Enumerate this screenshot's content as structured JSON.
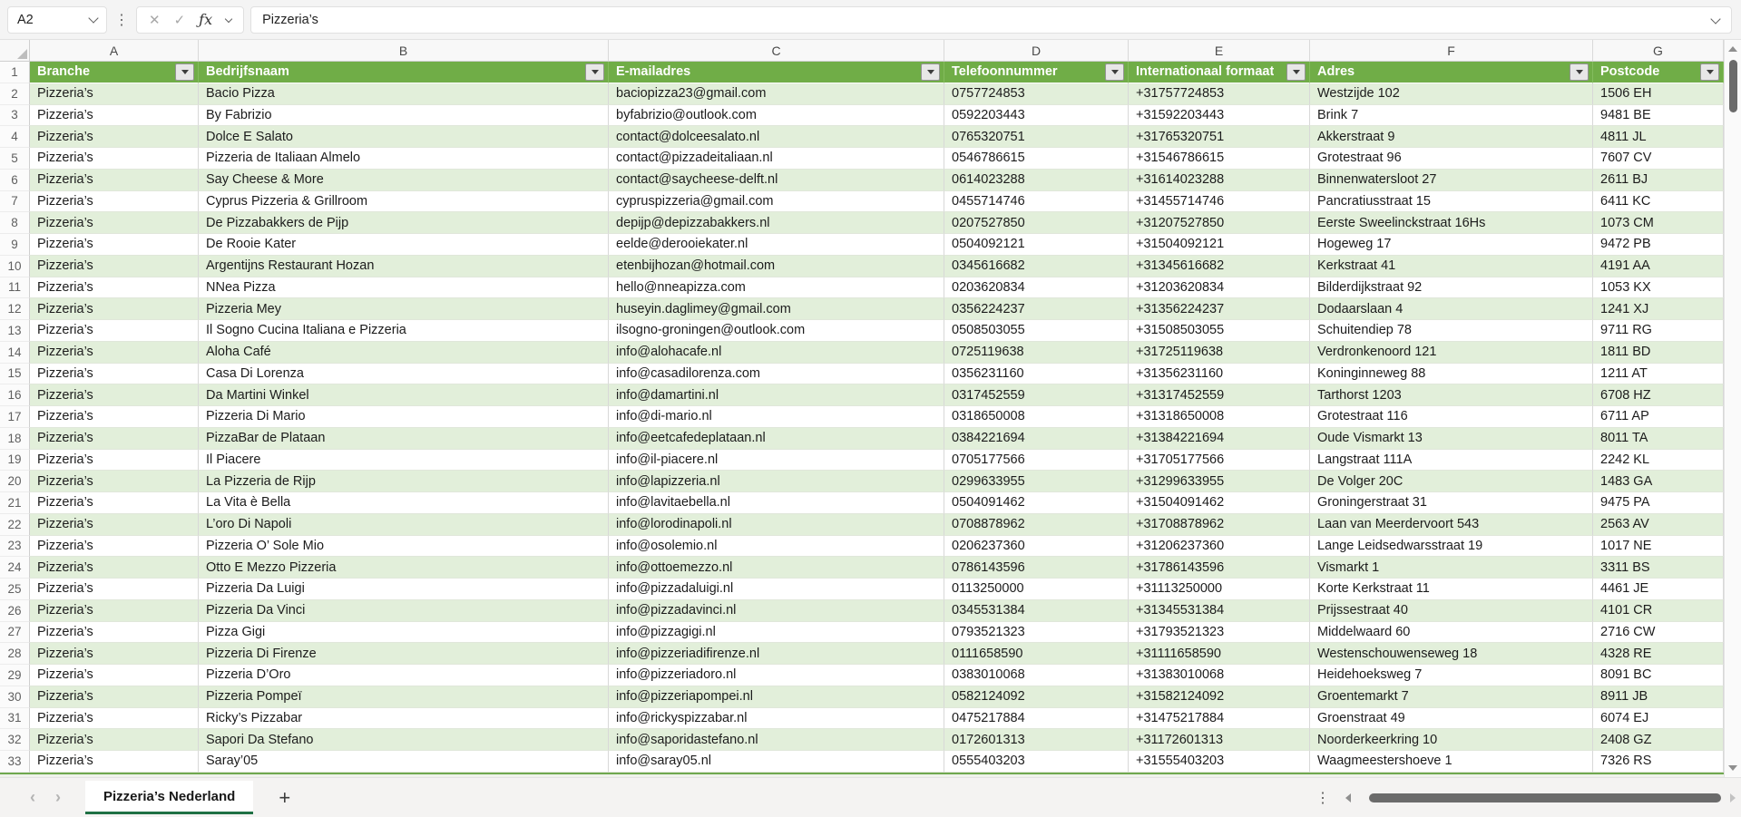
{
  "formula_bar": {
    "name_box": "A2",
    "formula": "Pizzeria’s"
  },
  "icons": {
    "cancel": "✕",
    "confirm": "✓",
    "function": "ƒx",
    "kebab": "⋮",
    "add": "+"
  },
  "colors": {
    "table_header_green": "#70AD47",
    "banded_row_green": "#E2EFDA",
    "active_tab_underline": "#1F7044"
  },
  "sheet": {
    "columns": [
      {
        "letter": "A",
        "header": "Branche"
      },
      {
        "letter": "B",
        "header": "Bedrijfsnaam"
      },
      {
        "letter": "C",
        "header": "E-mailadres"
      },
      {
        "letter": "D",
        "header": "Telefoonnummer"
      },
      {
        "letter": "E",
        "header": "Internationaal formaat"
      },
      {
        "letter": "F",
        "header": "Adres"
      },
      {
        "letter": "G",
        "header": "Postcode"
      }
    ],
    "header_row_number": "1",
    "rows": [
      [
        "Pizzeria’s",
        "Bacio Pizza",
        "baciopizza23@gmail.com",
        "0757724853",
        "+31757724853",
        "Westzijde 102",
        "1506 EH"
      ],
      [
        "Pizzeria’s",
        "By Fabrizio",
        "byfabrizio@outlook.com",
        "0592203443",
        "+31592203443",
        "Brink 7",
        "9481 BE"
      ],
      [
        "Pizzeria’s",
        "Dolce E Salato",
        "contact@dolceesalato.nl",
        "0765320751",
        "+31765320751",
        "Akkerstraat 9",
        "4811 JL"
      ],
      [
        "Pizzeria’s",
        "Pizzeria de Italiaan Almelo",
        "contact@pizzadeitaliaan.nl",
        "0546786615",
        "+31546786615",
        "Grotestraat 96",
        "7607 CV"
      ],
      [
        "Pizzeria’s",
        "Say Cheese & More",
        "contact@saycheese-delft.nl",
        "0614023288",
        "+31614023288",
        "Binnenwatersloot 27",
        "2611 BJ"
      ],
      [
        "Pizzeria’s",
        "Cyprus Pizzeria & Grillroom",
        "cypruspizzeria@gmail.com",
        "0455714746",
        "+31455714746",
        "Pancratiusstraat 15",
        "6411 KC"
      ],
      [
        "Pizzeria’s",
        "De Pizzabakkers de Pijp",
        "depijp@depizzabakkers.nl",
        "0207527850",
        "+31207527850",
        "Eerste Sweelinckstraat 16Hs",
        "1073 CM"
      ],
      [
        "Pizzeria’s",
        "De Rooie Kater",
        "eelde@derooiekater.nl",
        "0504092121",
        "+31504092121",
        "Hogeweg 17",
        "9472 PB"
      ],
      [
        "Pizzeria’s",
        "Argentijns Restaurant Hozan",
        "etenbijhozan@hotmail.com",
        "0345616682",
        "+31345616682",
        "Kerkstraat 41",
        "4191 AA"
      ],
      [
        "Pizzeria’s",
        "NNea Pizza",
        "hello@nneapizza.com",
        "0203620834",
        "+31203620834",
        "Bilderdijkstraat 92",
        "1053 KX"
      ],
      [
        "Pizzeria’s",
        "Pizzeria Mey",
        "huseyin.daglimey@gmail.com",
        "0356224237",
        "+31356224237",
        "Dodaarslaan 4",
        "1241 XJ"
      ],
      [
        "Pizzeria’s",
        "Il Sogno Cucina Italiana e Pizzeria",
        "ilsogno-groningen@outlook.com",
        "0508503055",
        "+31508503055",
        "Schuitendiep 78",
        "9711 RG"
      ],
      [
        "Pizzeria’s",
        "Aloha Café",
        "info@alohacafe.nl",
        "0725119638",
        "+31725119638",
        "Verdronkenoord 121",
        "1811 BD"
      ],
      [
        "Pizzeria’s",
        "Casa Di Lorenza",
        "info@casadilorenza.com",
        "0356231160",
        "+31356231160",
        "Koninginneweg 88",
        "1211 AT"
      ],
      [
        "Pizzeria’s",
        "Da Martini Winkel",
        "info@damartini.nl",
        "0317452559",
        "+31317452559",
        "Tarthorst 1203",
        "6708 HZ"
      ],
      [
        "Pizzeria’s",
        "Pizzeria Di Mario",
        "info@di-mario.nl",
        "0318650008",
        "+31318650008",
        "Grotestraat 116",
        "6711 AP"
      ],
      [
        "Pizzeria’s",
        "PizzaBar de Plataan",
        "info@eetcafedeplataan.nl",
        "0384221694",
        "+31384221694",
        "Oude Vismarkt 13",
        "8011 TA"
      ],
      [
        "Pizzeria’s",
        "Il Piacere",
        "info@il-piacere.nl",
        "0705177566",
        "+31705177566",
        "Langstraat 111A",
        "2242 KL"
      ],
      [
        "Pizzeria’s",
        "La Pizzeria de Rijp",
        "info@lapizzeria.nl",
        "0299633955",
        "+31299633955",
        "De Volger 20C",
        "1483 GA"
      ],
      [
        "Pizzeria’s",
        "La Vita è Bella",
        "info@lavitaebella.nl",
        "0504091462",
        "+31504091462",
        "Groningerstraat 31",
        "9475 PA"
      ],
      [
        "Pizzeria’s",
        "L’oro Di Napoli",
        "info@lorodinapoli.nl",
        "0708878962",
        "+31708878962",
        "Laan van Meerdervoort 543",
        "2563 AV"
      ],
      [
        "Pizzeria’s",
        "Pizzeria O’ Sole Mio",
        "info@osolemio.nl",
        "0206237360",
        "+31206237360",
        "Lange Leidsedwarsstraat 19",
        "1017 NE"
      ],
      [
        "Pizzeria’s",
        "Otto E Mezzo Pizzeria",
        "info@ottoemezzo.nl",
        "0786143596",
        "+31786143596",
        "Vismarkt 1",
        "3311 BS"
      ],
      [
        "Pizzeria’s",
        "Pizzeria Da Luigi",
        "info@pizzadaluigi.nl",
        "0113250000",
        "+31113250000",
        "Korte Kerkstraat 11",
        "4461 JE"
      ],
      [
        "Pizzeria’s",
        "Pizzeria Da Vinci",
        "info@pizzadavinci.nl",
        "0345531384",
        "+31345531384",
        "Prijssestraat 40",
        "4101 CR"
      ],
      [
        "Pizzeria’s",
        "Pizza Gigi",
        "info@pizzagigi.nl",
        "0793521323",
        "+31793521323",
        "Middelwaard 60",
        "2716 CW"
      ],
      [
        "Pizzeria’s",
        "Pizzeria Di Firenze",
        "info@pizzeriadifirenze.nl",
        "0111658590",
        "+31111658590",
        "Westenschouwenseweg 18",
        "4328 RE"
      ],
      [
        "Pizzeria’s",
        "Pizzeria D’Oro",
        "info@pizzeriadoro.nl",
        "0383010068",
        "+31383010068",
        "Heidehoeksweg 7",
        "8091 BC"
      ],
      [
        "Pizzeria’s",
        "Pizzeria Pompeï",
        "info@pizzeriapompei.nl",
        "0582124092",
        "+31582124092",
        "Groentemarkt 7",
        "8911 JB"
      ],
      [
        "Pizzeria’s",
        "Ricky’s Pizzabar",
        "info@rickyspizzabar.nl",
        "0475217884",
        "+31475217884",
        "Groenstraat 49",
        "6074 EJ"
      ],
      [
        "Pizzeria’s",
        "Sapori Da Stefano",
        "info@saporidastefano.nl",
        "0172601313",
        "+31172601313",
        "Noorderkeerkring 10",
        "2408 GZ"
      ],
      [
        "Pizzeria’s",
        "Saray’05",
        "info@saray05.nl",
        "0555403203",
        "+31555403203",
        "Waagmeestershoeve 1",
        "7326 RS"
      ]
    ]
  },
  "tab_bar": {
    "active_tab": "Pizzeria’s Nederland"
  }
}
